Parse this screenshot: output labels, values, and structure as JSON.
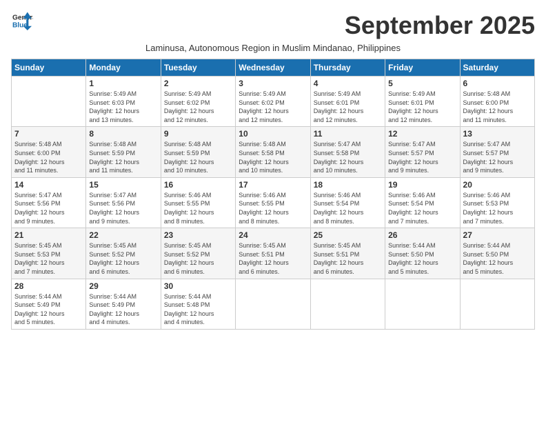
{
  "logo": {
    "line1": "General",
    "line2": "Blue"
  },
  "title": "September 2025",
  "subtitle": "Laminusa, Autonomous Region in Muslim Mindanao, Philippines",
  "weekdays": [
    "Sunday",
    "Monday",
    "Tuesday",
    "Wednesday",
    "Thursday",
    "Friday",
    "Saturday"
  ],
  "weeks": [
    [
      {
        "day": "",
        "detail": ""
      },
      {
        "day": "1",
        "detail": "Sunrise: 5:49 AM\nSunset: 6:03 PM\nDaylight: 12 hours\nand 13 minutes."
      },
      {
        "day": "2",
        "detail": "Sunrise: 5:49 AM\nSunset: 6:02 PM\nDaylight: 12 hours\nand 12 minutes."
      },
      {
        "day": "3",
        "detail": "Sunrise: 5:49 AM\nSunset: 6:02 PM\nDaylight: 12 hours\nand 12 minutes."
      },
      {
        "day": "4",
        "detail": "Sunrise: 5:49 AM\nSunset: 6:01 PM\nDaylight: 12 hours\nand 12 minutes."
      },
      {
        "day": "5",
        "detail": "Sunrise: 5:49 AM\nSunset: 6:01 PM\nDaylight: 12 hours\nand 12 minutes."
      },
      {
        "day": "6",
        "detail": "Sunrise: 5:48 AM\nSunset: 6:00 PM\nDaylight: 12 hours\nand 11 minutes."
      }
    ],
    [
      {
        "day": "7",
        "detail": "Sunrise: 5:48 AM\nSunset: 6:00 PM\nDaylight: 12 hours\nand 11 minutes."
      },
      {
        "day": "8",
        "detail": "Sunrise: 5:48 AM\nSunset: 5:59 PM\nDaylight: 12 hours\nand 11 minutes."
      },
      {
        "day": "9",
        "detail": "Sunrise: 5:48 AM\nSunset: 5:59 PM\nDaylight: 12 hours\nand 10 minutes."
      },
      {
        "day": "10",
        "detail": "Sunrise: 5:48 AM\nSunset: 5:58 PM\nDaylight: 12 hours\nand 10 minutes."
      },
      {
        "day": "11",
        "detail": "Sunrise: 5:47 AM\nSunset: 5:58 PM\nDaylight: 12 hours\nand 10 minutes."
      },
      {
        "day": "12",
        "detail": "Sunrise: 5:47 AM\nSunset: 5:57 PM\nDaylight: 12 hours\nand 9 minutes."
      },
      {
        "day": "13",
        "detail": "Sunrise: 5:47 AM\nSunset: 5:57 PM\nDaylight: 12 hours\nand 9 minutes."
      }
    ],
    [
      {
        "day": "14",
        "detail": "Sunrise: 5:47 AM\nSunset: 5:56 PM\nDaylight: 12 hours\nand 9 minutes."
      },
      {
        "day": "15",
        "detail": "Sunrise: 5:47 AM\nSunset: 5:56 PM\nDaylight: 12 hours\nand 9 minutes."
      },
      {
        "day": "16",
        "detail": "Sunrise: 5:46 AM\nSunset: 5:55 PM\nDaylight: 12 hours\nand 8 minutes."
      },
      {
        "day": "17",
        "detail": "Sunrise: 5:46 AM\nSunset: 5:55 PM\nDaylight: 12 hours\nand 8 minutes."
      },
      {
        "day": "18",
        "detail": "Sunrise: 5:46 AM\nSunset: 5:54 PM\nDaylight: 12 hours\nand 8 minutes."
      },
      {
        "day": "19",
        "detail": "Sunrise: 5:46 AM\nSunset: 5:54 PM\nDaylight: 12 hours\nand 7 minutes."
      },
      {
        "day": "20",
        "detail": "Sunrise: 5:46 AM\nSunset: 5:53 PM\nDaylight: 12 hours\nand 7 minutes."
      }
    ],
    [
      {
        "day": "21",
        "detail": "Sunrise: 5:45 AM\nSunset: 5:53 PM\nDaylight: 12 hours\nand 7 minutes."
      },
      {
        "day": "22",
        "detail": "Sunrise: 5:45 AM\nSunset: 5:52 PM\nDaylight: 12 hours\nand 6 minutes."
      },
      {
        "day": "23",
        "detail": "Sunrise: 5:45 AM\nSunset: 5:52 PM\nDaylight: 12 hours\nand 6 minutes."
      },
      {
        "day": "24",
        "detail": "Sunrise: 5:45 AM\nSunset: 5:51 PM\nDaylight: 12 hours\nand 6 minutes."
      },
      {
        "day": "25",
        "detail": "Sunrise: 5:45 AM\nSunset: 5:51 PM\nDaylight: 12 hours\nand 6 minutes."
      },
      {
        "day": "26",
        "detail": "Sunrise: 5:44 AM\nSunset: 5:50 PM\nDaylight: 12 hours\nand 5 minutes."
      },
      {
        "day": "27",
        "detail": "Sunrise: 5:44 AM\nSunset: 5:50 PM\nDaylight: 12 hours\nand 5 minutes."
      }
    ],
    [
      {
        "day": "28",
        "detail": "Sunrise: 5:44 AM\nSunset: 5:49 PM\nDaylight: 12 hours\nand 5 minutes."
      },
      {
        "day": "29",
        "detail": "Sunrise: 5:44 AM\nSunset: 5:49 PM\nDaylight: 12 hours\nand 4 minutes."
      },
      {
        "day": "30",
        "detail": "Sunrise: 5:44 AM\nSunset: 5:48 PM\nDaylight: 12 hours\nand 4 minutes."
      },
      {
        "day": "",
        "detail": ""
      },
      {
        "day": "",
        "detail": ""
      },
      {
        "day": "",
        "detail": ""
      },
      {
        "day": "",
        "detail": ""
      }
    ]
  ]
}
